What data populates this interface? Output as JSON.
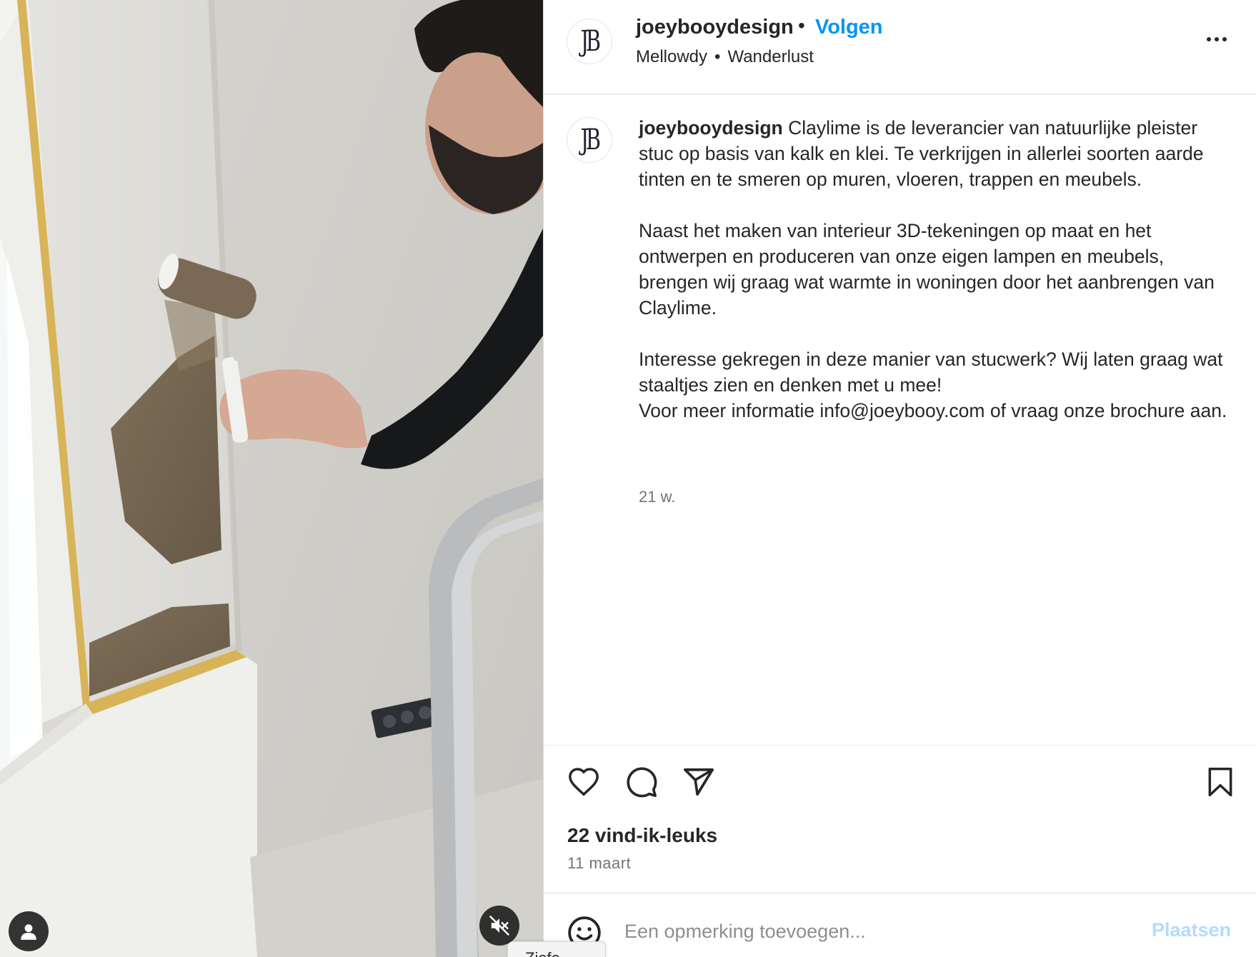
{
  "media": {
    "profile_button_icon": "user-icon",
    "mute_button_icon": "speaker-muted-icon"
  },
  "header": {
    "username": "joeybooydesign",
    "separator": "•",
    "follow_label": "Volgen",
    "audio_artist": "Mellowdy",
    "audio_separator": "•",
    "audio_track": "Wanderlust",
    "avatar_monogram": "JB",
    "more_icon": "more-options-icon"
  },
  "caption": {
    "username": "joeybooydesign",
    "paragraph_1": "Claylime is de leverancier van natuurlijke pleister stuc op basis van kalk en klei. Te verkrijgen in allerlei soorten aarde tinten en te smeren op muren, vloeren, trappen en meubels.",
    "paragraph_2": "Naast het maken van interieur 3D-tekeningen op maat en het ontwerpen en produceren van onze eigen lampen en meubels, brengen wij graag wat warmte in woningen door het aanbrengen van Claylime.",
    "paragraph_3_line_1": "Interesse gekregen in deze manier van stucwerk? Wij laten graag wat staaltjes zien en denken met u mee!",
    "paragraph_3_line_2": "Voor meer informatie info@joeybooy.com of vraag onze brochure aan.",
    "age": "21 w."
  },
  "actions": {
    "like_icon": "heart-icon",
    "comment_icon": "comment-icon",
    "share_icon": "send-icon",
    "save_icon": "bookmark-icon",
    "likes": "22 vind-ik-leuks",
    "date": "11 maart"
  },
  "comment_bar": {
    "emoji_icon": "emoji-icon",
    "placeholder": "Een opmerking toevoegen...",
    "post_label": "Plaatsen",
    "tooltip_text": "Ziefe..."
  },
  "colors": {
    "link_blue": "#0095f6",
    "post_disabled": "#b3dbff",
    "muted_text": "#737373",
    "border": "#dbdbdb"
  }
}
